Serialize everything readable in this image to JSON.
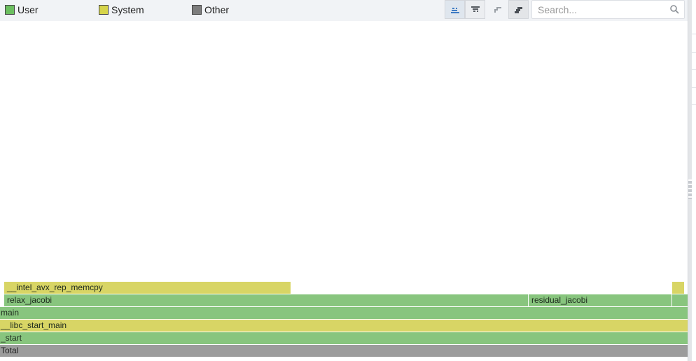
{
  "legend": [
    {
      "label": "User",
      "color": "#6cbf60"
    },
    {
      "label": "System",
      "color": "#d6d44a"
    },
    {
      "label": "Other",
      "color": "#7d7d7d"
    }
  ],
  "toolbar": {
    "buttons": [
      {
        "icon": "flame-up-icon",
        "active": true
      },
      {
        "icon": "icicle-down-icon",
        "active": false
      },
      {
        "icon": "collapse-icon",
        "active": false
      },
      {
        "icon": "expand-icon",
        "active": true
      }
    ]
  },
  "search": {
    "placeholder": "Search...",
    "value": "",
    "icon": "search-icon"
  },
  "flamegraph": {
    "frames": {
      "total": "Total",
      "start": "_start",
      "libc_start_main": "__libc_start_main",
      "main": "main",
      "relax_jacobi": "relax_jacobi",
      "residual_jacobi": "residual_jacobi",
      "intel_avx_rep_memcpy": "__intel_avx_rep_memcpy",
      "unnamed_right_user": "",
      "unnamed_right_system": ""
    }
  }
}
